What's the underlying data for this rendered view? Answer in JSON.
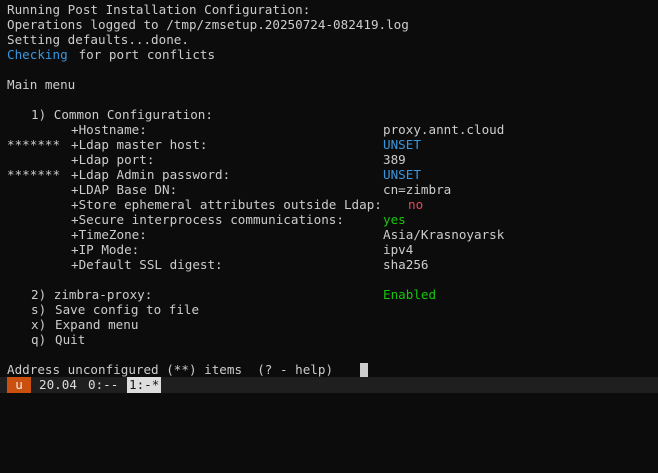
{
  "header": {
    "title": "Running Post Installation Configuration:",
    "log_line": "Operations logged to /tmp/zmsetup.20250724-082419.log",
    "defaults_line": "Setting defaults...done.",
    "checking_word": "Checking",
    "checking_rest": " for port conflicts"
  },
  "main_menu": {
    "title": "Main menu",
    "section1": {
      "label": "1) Common Configuration:",
      "items": [
        {
          "marker": "",
          "label": "+Hostname:",
          "value": "proxy.annt.cloud",
          "color": "#cccccc"
        },
        {
          "marker": "*******",
          "label": "+Ldap master host:",
          "value": "UNSET",
          "color": "#3a96dd"
        },
        {
          "marker": "",
          "label": "+Ldap port:",
          "value": "389",
          "color": "#cccccc"
        },
        {
          "marker": "*******",
          "label": "+Ldap Admin password:",
          "value": "UNSET",
          "color": "#3a96dd"
        },
        {
          "marker": "",
          "label": "+LDAP Base DN:",
          "value": "cn=zimbra",
          "color": "#cccccc"
        },
        {
          "marker": "",
          "label": "+Store ephemeral attributes outside Ldap:",
          "value": "no",
          "color": "#e74856"
        },
        {
          "marker": "",
          "label": "+Secure interprocess communications:",
          "value": "yes",
          "color": "#16c60c"
        },
        {
          "marker": "",
          "label": "+TimeZone:",
          "value": "Asia/Krasnoyarsk",
          "color": "#cccccc"
        },
        {
          "marker": "",
          "label": "+IP Mode:",
          "value": "ipv4",
          "color": "#cccccc"
        },
        {
          "marker": "",
          "label": "+Default SSL digest:",
          "value": "sha256",
          "color": "#cccccc"
        }
      ]
    },
    "section2": {
      "label": "2) zimbra-proxy:",
      "value": "Enabled",
      "color": "#16c60c"
    },
    "options": [
      {
        "key": "s)",
        "label": "Save config to file"
      },
      {
        "key": "x)",
        "label": "Expand menu"
      },
      {
        "key": "q)",
        "label": "Quit"
      }
    ]
  },
  "prompt": {
    "text": "Address unconfigured (**) items  (? - help)"
  },
  "tmux": {
    "session": "u",
    "host": "20.04",
    "window_inactive": "0:--",
    "window_active": "1:-*"
  }
}
